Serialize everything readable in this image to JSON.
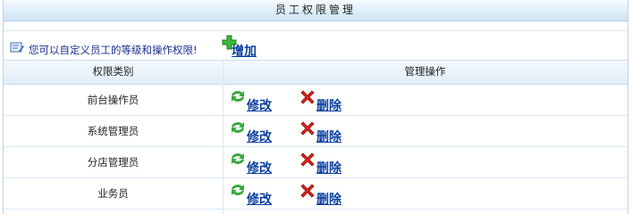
{
  "header": {
    "title": "员工权限管理"
  },
  "info": {
    "note": "您可以自定义员工的等级和操作权限!",
    "add_label": "增加"
  },
  "table": {
    "columns": [
      "权限类别",
      "管理操作"
    ],
    "rows": [
      {
        "role": "前台操作员",
        "edit_label": "修改",
        "delete_label": "删除"
      },
      {
        "role": "系统管理员",
        "edit_label": "修改",
        "delete_label": "删除"
      },
      {
        "role": "分店管理员",
        "edit_label": "修改",
        "delete_label": "删除"
      },
      {
        "role": "业务员",
        "edit_label": "修改",
        "delete_label": "删除"
      }
    ]
  },
  "icons": {
    "note": "edit-note-icon",
    "add": "green-plus-icon",
    "edit": "refresh-arrows-icon",
    "delete": "red-x-icon"
  },
  "colors": {
    "link": "#0a3f9e",
    "note_text": "#1a2e8c",
    "header_bg": "#ddeefa",
    "border": "#b9d3ea"
  }
}
